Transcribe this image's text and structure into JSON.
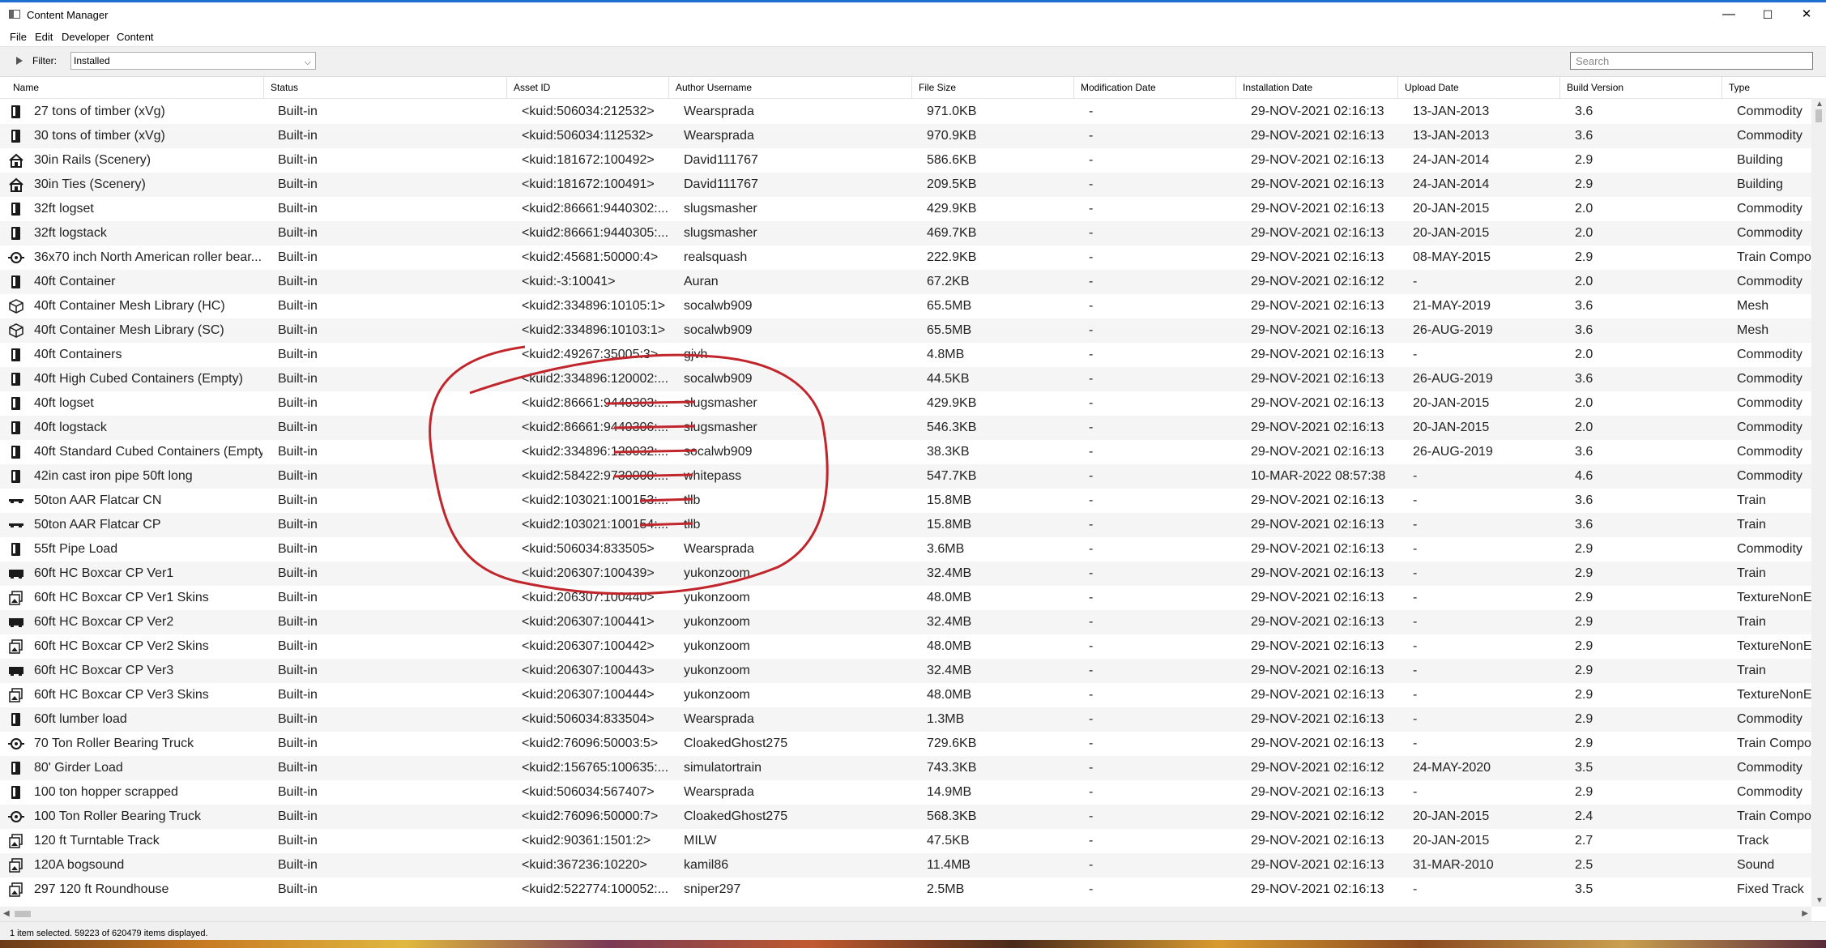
{
  "window": {
    "title": "Content Manager",
    "minimize": "—",
    "maximize": "☐",
    "close": "✕"
  },
  "menu": [
    "File",
    "Edit",
    "Developer",
    "Content"
  ],
  "filterbar": {
    "label": "Filter:",
    "selected": "Installed",
    "search_placeholder": "Search"
  },
  "columns": [
    "Name",
    "Status",
    "Asset ID",
    "Author Username",
    "File Size",
    "Modification Date",
    "Installation Date",
    "Upload Date",
    "Build Version",
    "Type"
  ],
  "rows": [
    {
      "icon": "commodity-icon",
      "name": "27 tons of timber (xVg)",
      "status": "Built-in",
      "asset": "<kuid:506034:212532>",
      "author": "Wearsprada",
      "size": "971.0KB",
      "mod": "-",
      "install": "29-NOV-2021 02:16:13",
      "upload": "13-JAN-2013",
      "build": "3.6",
      "type": "Commodity"
    },
    {
      "icon": "commodity-icon",
      "name": "30 tons of timber (xVg)",
      "status": "Built-in",
      "asset": "<kuid:506034:112532>",
      "author": "Wearsprada",
      "size": "970.9KB",
      "mod": "-",
      "install": "29-NOV-2021 02:16:13",
      "upload": "13-JAN-2013",
      "build": "3.6",
      "type": "Commodity"
    },
    {
      "icon": "building-icon",
      "name": "30in Rails (Scenery)",
      "status": "Built-in",
      "asset": "<kuid:181672:100492>",
      "author": "David111767",
      "size": "586.6KB",
      "mod": "-",
      "install": "29-NOV-2021 02:16:13",
      "upload": "24-JAN-2014",
      "build": "2.9",
      "type": "Building"
    },
    {
      "icon": "building-icon",
      "name": "30in Ties (Scenery)",
      "status": "Built-in",
      "asset": "<kuid:181672:100491>",
      "author": "David111767",
      "size": "209.5KB",
      "mod": "-",
      "install": "29-NOV-2021 02:16:13",
      "upload": "24-JAN-2014",
      "build": "2.9",
      "type": "Building"
    },
    {
      "icon": "commodity-icon",
      "name": "32ft logset",
      "status": "Built-in",
      "asset": "<kuid2:86661:9440302:...",
      "author": "slugsmasher",
      "size": "429.9KB",
      "mod": "-",
      "install": "29-NOV-2021 02:16:13",
      "upload": "20-JAN-2015",
      "build": "2.0",
      "type": "Commodity"
    },
    {
      "icon": "commodity-icon",
      "name": "32ft logstack",
      "status": "Built-in",
      "asset": "<kuid2:86661:9440305:...",
      "author": "slugsmasher",
      "size": "469.7KB",
      "mod": "-",
      "install": "29-NOV-2021 02:16:13",
      "upload": "20-JAN-2015",
      "build": "2.0",
      "type": "Commodity"
    },
    {
      "icon": "bogey-icon",
      "name": "36x70 inch North American roller bear...",
      "status": "Built-in",
      "asset": "<kuid2:45681:50000:4>",
      "author": "realsquash",
      "size": "222.9KB",
      "mod": "-",
      "install": "29-NOV-2021 02:16:13",
      "upload": "08-MAY-2015",
      "build": "2.9",
      "type": "Train Compo"
    },
    {
      "icon": "commodity-icon",
      "name": "40ft Container",
      "status": "Built-in",
      "asset": "<kuid:-3:10041>",
      "author": "Auran",
      "size": "67.2KB",
      "mod": "-",
      "install": "29-NOV-2021 02:16:12",
      "upload": "-",
      "build": "2.0",
      "type": "Commodity"
    },
    {
      "icon": "mesh-icon",
      "name": "40ft Container Mesh Library (HC)",
      "status": "Built-in",
      "asset": "<kuid2:334896:10105:1>",
      "author": "socalwb909",
      "size": "65.5MB",
      "mod": "-",
      "install": "29-NOV-2021 02:16:13",
      "upload": "21-MAY-2019",
      "build": "3.6",
      "type": "Mesh"
    },
    {
      "icon": "mesh-icon",
      "name": "40ft Container Mesh Library (SC)",
      "status": "Built-in",
      "asset": "<kuid2:334896:10103:1>",
      "author": "socalwb909",
      "size": "65.5MB",
      "mod": "-",
      "install": "29-NOV-2021 02:16:13",
      "upload": "26-AUG-2019",
      "build": "3.6",
      "type": "Mesh"
    },
    {
      "icon": "commodity-icon",
      "name": "40ft Containers",
      "status": "Built-in",
      "asset": "<kuid2:49267:35005:3>",
      "author": "gjvh",
      "size": "4.8MB",
      "mod": "-",
      "install": "29-NOV-2021 02:16:13",
      "upload": "-",
      "build": "2.0",
      "type": "Commodity"
    },
    {
      "icon": "commodity-icon",
      "name": "40ft High Cubed Containers (Empty)",
      "status": "Built-in",
      "asset": "<kuid2:334896:120002:...",
      "author": "socalwb909",
      "size": "44.5KB",
      "mod": "-",
      "install": "29-NOV-2021 02:16:13",
      "upload": "26-AUG-2019",
      "build": "3.6",
      "type": "Commodity"
    },
    {
      "icon": "commodity-icon",
      "name": "40ft logset",
      "status": "Built-in",
      "asset": "<kuid2:86661:9440303:...",
      "author": "slugsmasher",
      "size": "429.9KB",
      "mod": "-",
      "install": "29-NOV-2021 02:16:13",
      "upload": "20-JAN-2015",
      "build": "2.0",
      "type": "Commodity"
    },
    {
      "icon": "commodity-icon",
      "name": "40ft logstack",
      "status": "Built-in",
      "asset": "<kuid2:86661:9440306:...",
      "author": "slugsmasher",
      "size": "546.3KB",
      "mod": "-",
      "install": "29-NOV-2021 02:16:13",
      "upload": "20-JAN-2015",
      "build": "2.0",
      "type": "Commodity"
    },
    {
      "icon": "commodity-icon",
      "name": "40ft Standard Cubed Containers (Empty)",
      "status": "Built-in",
      "asset": "<kuid2:334896:120032:...",
      "author": "socalwb909",
      "size": "38.3KB",
      "mod": "-",
      "install": "29-NOV-2021 02:16:13",
      "upload": "26-AUG-2019",
      "build": "3.6",
      "type": "Commodity"
    },
    {
      "icon": "commodity-icon",
      "name": "42in cast iron pipe 50ft long",
      "status": "Built-in",
      "asset": "<kuid2:58422:9730000:...",
      "author": "whitepass",
      "size": "547.7KB",
      "mod": "-",
      "install": "10-MAR-2022 08:57:38",
      "upload": "-",
      "build": "4.6",
      "type": "Commodity"
    },
    {
      "icon": "flatcar-icon",
      "name": "50ton AAR Flatcar CN",
      "status": "Built-in",
      "asset": "<kuid2:103021:100153:...",
      "author": "tllb",
      "size": "15.8MB",
      "mod": "-",
      "install": "29-NOV-2021 02:16:13",
      "upload": "-",
      "build": "3.6",
      "type": "Train"
    },
    {
      "icon": "flatcar-icon",
      "name": "50ton AAR Flatcar CP",
      "status": "Built-in",
      "asset": "<kuid2:103021:100154:...",
      "author": "tllb",
      "size": "15.8MB",
      "mod": "-",
      "install": "29-NOV-2021 02:16:13",
      "upload": "-",
      "build": "3.6",
      "type": "Train"
    },
    {
      "icon": "commodity-icon",
      "name": "55ft Pipe Load",
      "status": "Built-in",
      "asset": "<kuid:506034:833505>",
      "author": "Wearsprada",
      "size": "3.6MB",
      "mod": "-",
      "install": "29-NOV-2021 02:16:13",
      "upload": "-",
      "build": "2.9",
      "type": "Commodity"
    },
    {
      "icon": "boxcar-icon",
      "name": "60ft HC Boxcar CP Ver1",
      "status": "Built-in",
      "asset": "<kuid:206307:100439>",
      "author": "yukonzoom",
      "size": "32.4MB",
      "mod": "-",
      "install": "29-NOV-2021 02:16:13",
      "upload": "-",
      "build": "2.9",
      "type": "Train"
    },
    {
      "icon": "texture-icon",
      "name": "60ft HC Boxcar CP Ver1 Skins",
      "status": "Built-in",
      "asset": "<kuid:206307:100440>",
      "author": "yukonzoom",
      "size": "48.0MB",
      "mod": "-",
      "install": "29-NOV-2021 02:16:13",
      "upload": "-",
      "build": "2.9",
      "type": "TextureNonE"
    },
    {
      "icon": "boxcar-icon",
      "name": "60ft HC Boxcar CP Ver2",
      "status": "Built-in",
      "asset": "<kuid:206307:100441>",
      "author": "yukonzoom",
      "size": "32.4MB",
      "mod": "-",
      "install": "29-NOV-2021 02:16:13",
      "upload": "-",
      "build": "2.9",
      "type": "Train"
    },
    {
      "icon": "texture-icon",
      "name": "60ft HC Boxcar CP Ver2 Skins",
      "status": "Built-in",
      "asset": "<kuid:206307:100442>",
      "author": "yukonzoom",
      "size": "48.0MB",
      "mod": "-",
      "install": "29-NOV-2021 02:16:13",
      "upload": "-",
      "build": "2.9",
      "type": "TextureNonE"
    },
    {
      "icon": "boxcar-icon",
      "name": "60ft HC Boxcar CP Ver3",
      "status": "Built-in",
      "asset": "<kuid:206307:100443>",
      "author": "yukonzoom",
      "size": "32.4MB",
      "mod": "-",
      "install": "29-NOV-2021 02:16:13",
      "upload": "-",
      "build": "2.9",
      "type": "Train"
    },
    {
      "icon": "texture-icon",
      "name": "60ft HC Boxcar CP Ver3 Skins",
      "status": "Built-in",
      "asset": "<kuid:206307:100444>",
      "author": "yukonzoom",
      "size": "48.0MB",
      "mod": "-",
      "install": "29-NOV-2021 02:16:13",
      "upload": "-",
      "build": "2.9",
      "type": "TextureNonE"
    },
    {
      "icon": "commodity-icon",
      "name": "60ft lumber load",
      "status": "Built-in",
      "asset": "<kuid:506034:833504>",
      "author": "Wearsprada",
      "size": "1.3MB",
      "mod": "-",
      "install": "29-NOV-2021 02:16:13",
      "upload": "-",
      "build": "2.9",
      "type": "Commodity"
    },
    {
      "icon": "bogey-icon",
      "name": "70 Ton Roller Bearing Truck",
      "status": "Built-in",
      "asset": "<kuid2:76096:50003:5>",
      "author": "CloakedGhost275",
      "size": "729.6KB",
      "mod": "-",
      "install": "29-NOV-2021 02:16:13",
      "upload": "-",
      "build": "2.9",
      "type": "Train Compo"
    },
    {
      "icon": "commodity-icon",
      "name": "80' Girder Load",
      "status": "Built-in",
      "asset": "<kuid2:156765:100635:...",
      "author": "simulatortrain",
      "size": "743.3KB",
      "mod": "-",
      "install": "29-NOV-2021 02:16:12",
      "upload": "24-MAY-2020",
      "build": "3.5",
      "type": "Commodity"
    },
    {
      "icon": "commodity-icon",
      "name": "100 ton hopper scrapped",
      "status": "Built-in",
      "asset": "<kuid:506034:567407>",
      "author": "Wearsprada",
      "size": "14.9MB",
      "mod": "-",
      "install": "29-NOV-2021 02:16:13",
      "upload": "-",
      "build": "2.9",
      "type": "Commodity"
    },
    {
      "icon": "bogey-icon",
      "name": "100 Ton Roller Bearing Truck",
      "status": "Built-in",
      "asset": "<kuid2:76096:50000:7>",
      "author": "CloakedGhost275",
      "size": "568.3KB",
      "mod": "-",
      "install": "29-NOV-2021 02:16:12",
      "upload": "20-JAN-2015",
      "build": "2.4",
      "type": "Train Compo"
    },
    {
      "icon": "texture-icon",
      "name": "120 ft Turntable Track",
      "status": "Built-in",
      "asset": "<kuid2:90361:1501:2>",
      "author": "MILW",
      "size": "47.5KB",
      "mod": "-",
      "install": "29-NOV-2021 02:16:13",
      "upload": "20-JAN-2015",
      "build": "2.7",
      "type": "Track"
    },
    {
      "icon": "texture-icon",
      "name": "120A bogsound",
      "status": "Built-in",
      "asset": "<kuid:367236:10220>",
      "author": "kamil86",
      "size": "11.4MB",
      "mod": "-",
      "install": "29-NOV-2021 02:16:13",
      "upload": "31-MAR-2010",
      "build": "2.5",
      "type": "Sound"
    },
    {
      "icon": "texture-icon",
      "name": "297 120 ft Roundhouse",
      "status": "Built-in",
      "asset": "<kuid2:522774:100052:...",
      "author": "sniper297",
      "size": "2.5MB",
      "mod": "-",
      "install": "29-NOV-2021 02:16:13",
      "upload": "-",
      "build": "3.5",
      "type": "Fixed Track"
    }
  ],
  "status": "1 item selected. 59223 of 620479 items displayed.",
  "colors": {
    "accent": "#1e6fd0",
    "annotation": "#c0262c"
  }
}
